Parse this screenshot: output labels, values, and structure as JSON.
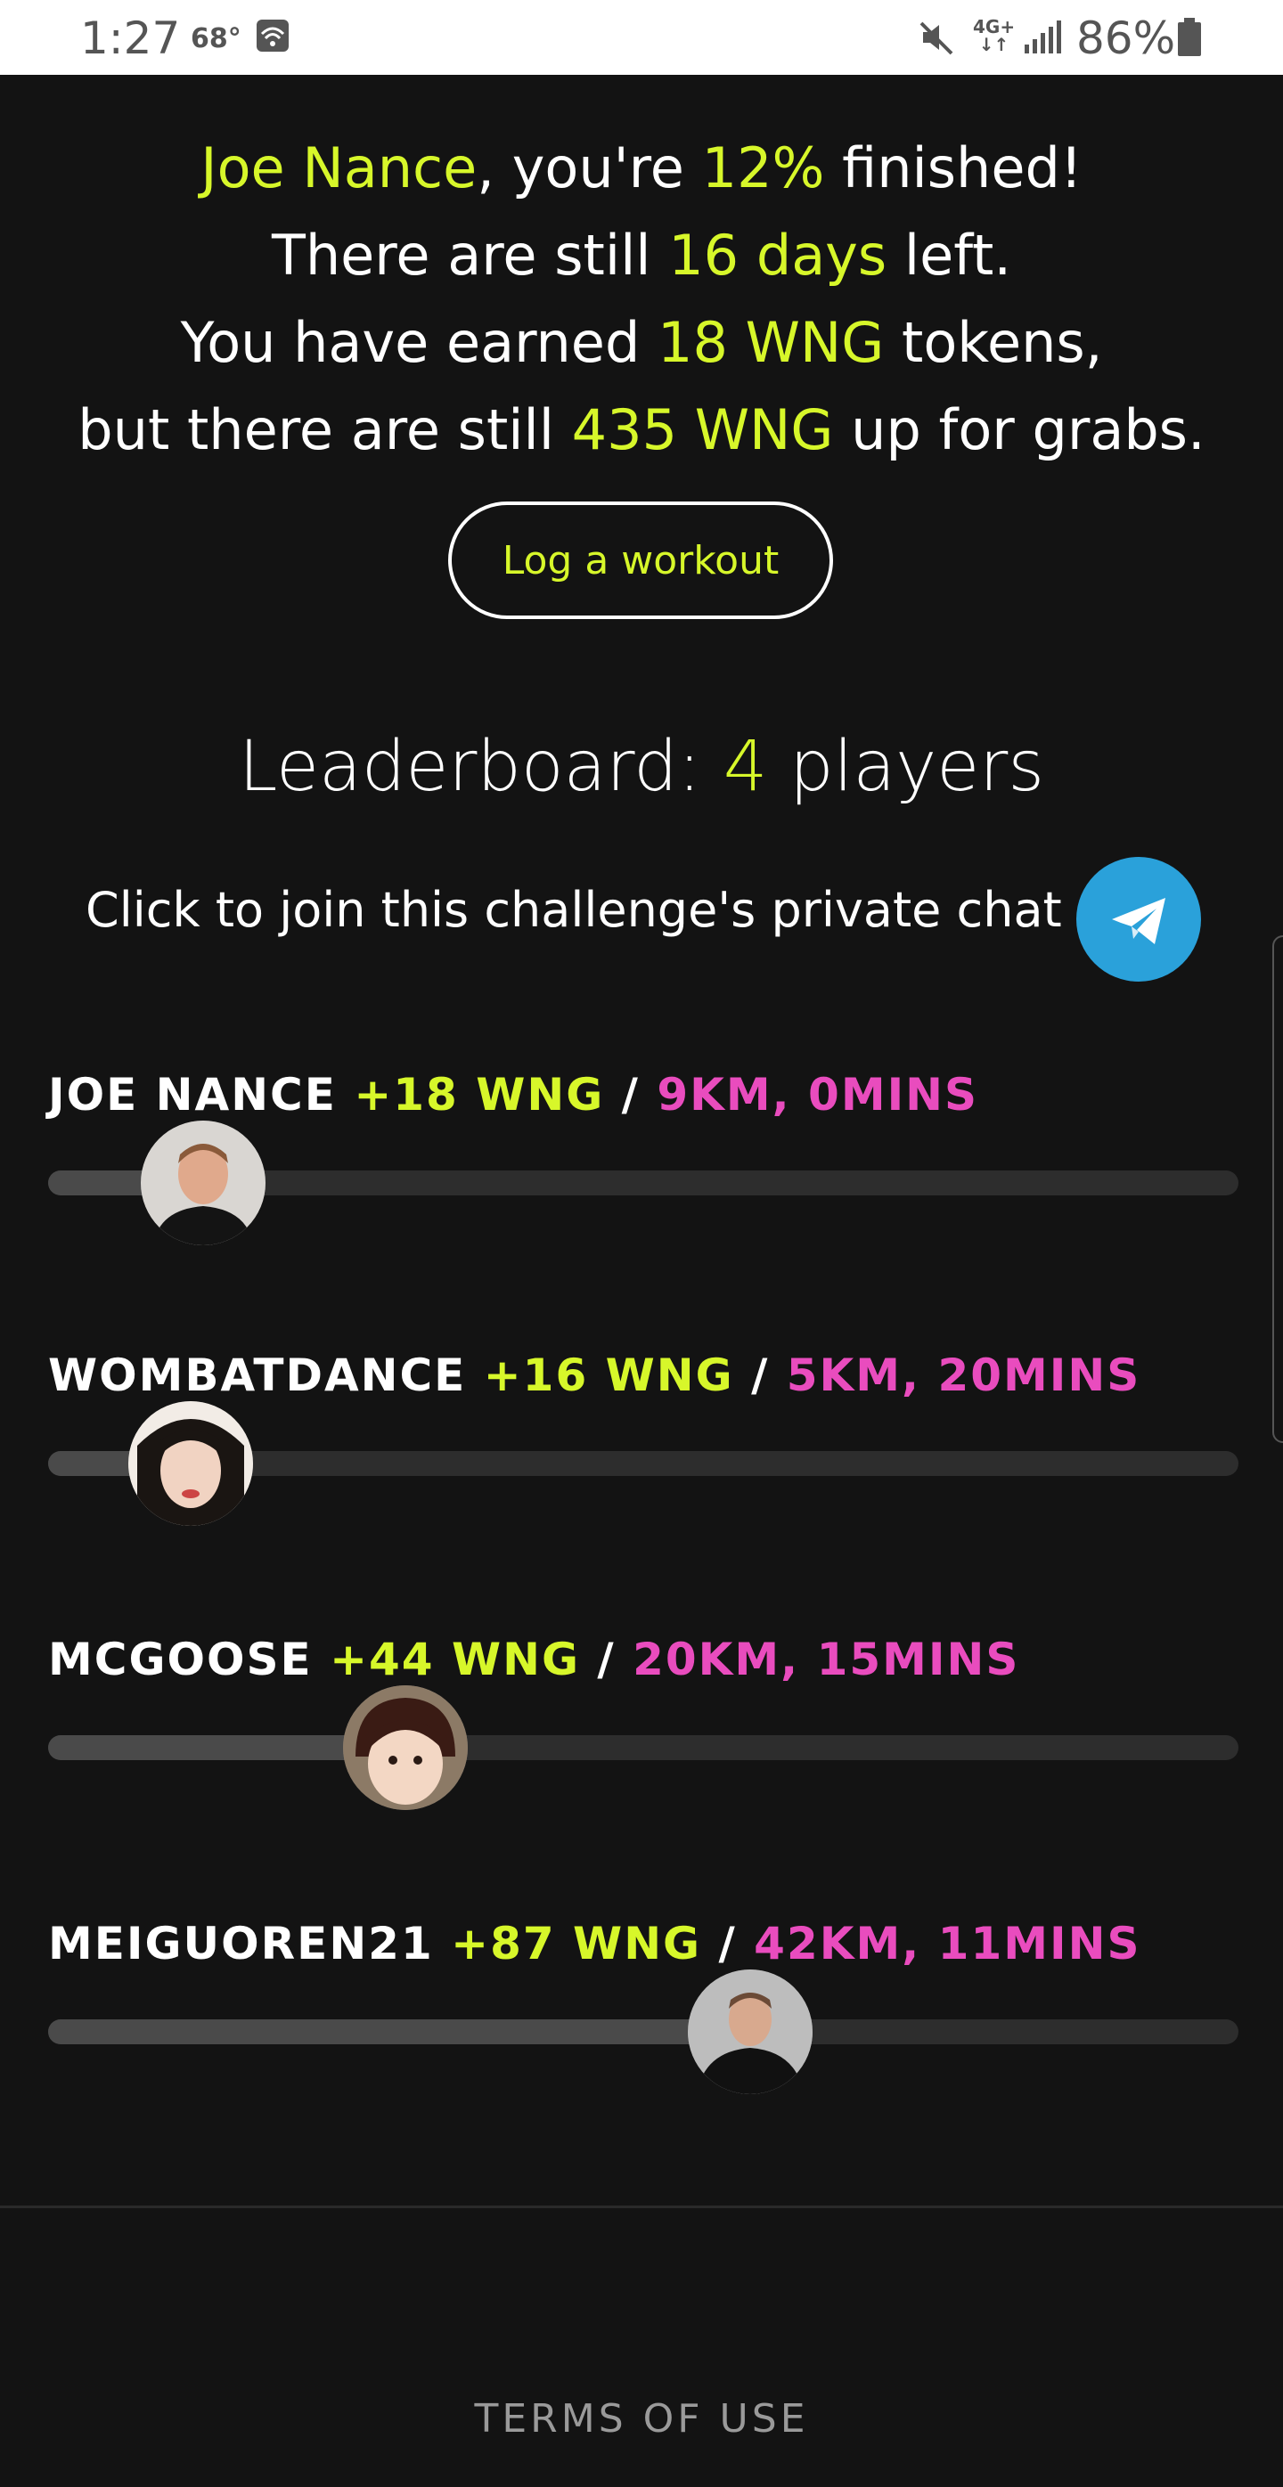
{
  "status_bar": {
    "time": "1:27",
    "temp": "68°",
    "network": "4G+",
    "battery": "86%",
    "icons": [
      "wifi-icon",
      "mute-icon",
      "signal-icon",
      "battery-icon"
    ]
  },
  "hero": {
    "name": "Joe Nance",
    "t1": ", you're ",
    "percent": "12%",
    "t2": " finished!",
    "t3": "There are still ",
    "days": "16 days",
    "t4": " left.",
    "t5": "You have earned ",
    "earned": "18 WNG",
    "t6": " tokens,",
    "t7": "but there are still ",
    "remaining": "435 WNG",
    "t8": " up for grabs."
  },
  "log_workout_label": "Log a workout",
  "leaderboard": {
    "title_prefix": "Leaderboard: ",
    "count": "4",
    "title_suffix": " players"
  },
  "chat": {
    "text": "Click to join this challenge's private chat",
    "icon": "telegram-icon"
  },
  "players": [
    {
      "name": "JOE NANCE",
      "points": "+18 WNG",
      "sep": " / ",
      "stats": "9KM, 0MINS",
      "progress": 0.13
    },
    {
      "name": "WOMBATDANCE",
      "points": "+16 WNG",
      "sep": " / ",
      "stats": "5KM, 20MINS",
      "progress": 0.12
    },
    {
      "name": "MCGOOSE",
      "points": "+44 WNG",
      "sep": " / ",
      "stats": "20KM, 15MINS",
      "progress": 0.3
    },
    {
      "name": "MEIGUOREN21",
      "points": "+87 WNG",
      "sep": " / ",
      "stats": "42KM, 11MINS",
      "progress": 0.59
    }
  ],
  "footer": {
    "terms": "TERMS OF USE"
  },
  "colors": {
    "background": "#131313",
    "accent": "#d7f72a",
    "stats": "#e94cbe",
    "telegram": "#2aa1da"
  }
}
